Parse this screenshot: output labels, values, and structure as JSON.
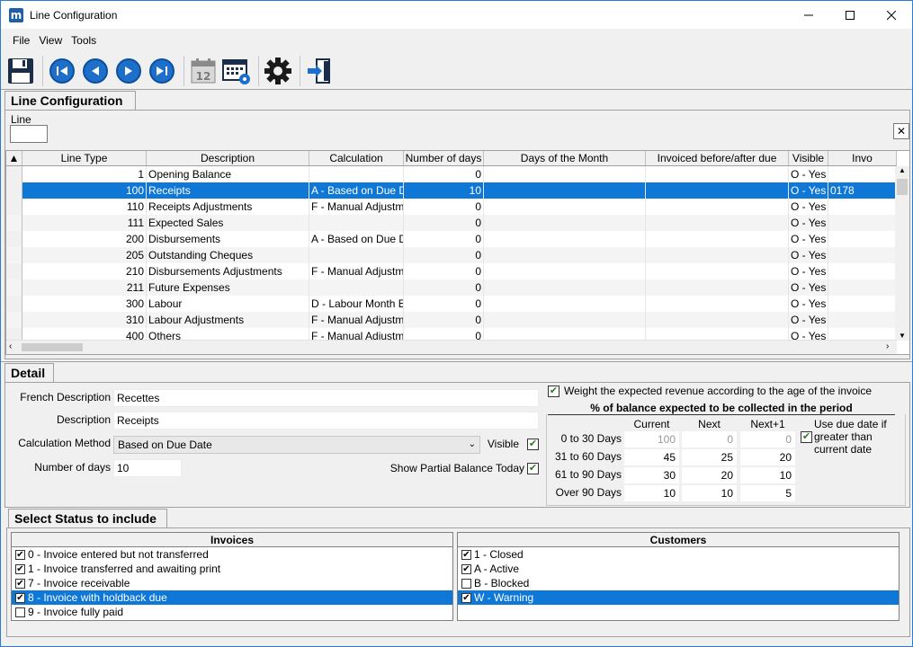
{
  "window": {
    "title": "Line Configuration",
    "app_icon_letter": "m"
  },
  "menu": [
    "File",
    "View",
    "Tools"
  ],
  "toolbar": {
    "icons": [
      "save-icon",
      "first-record-icon",
      "previous-record-icon",
      "next-record-icon",
      "last-record-icon",
      "calendar-icon",
      "calendar-settings-icon",
      "gear-icon",
      "exit-icon"
    ],
    "calendar_day": "12"
  },
  "top_tab": {
    "label": "Line Configuration",
    "line_label": "Line",
    "line_value": "",
    "close_glyph": "✕"
  },
  "grid": {
    "sort_glyph": "▲",
    "columns": [
      "Line Type",
      "Description",
      "Calculation",
      "Number of days",
      "Days of the Month",
      "Invoiced before/after due",
      "Visible",
      "Invo"
    ],
    "rows": [
      {
        "type": "1",
        "desc": "Opening Balance",
        "calc": "",
        "days": "0",
        "dom": "",
        "inv": "",
        "vis": "O - Yes",
        "invo": ""
      },
      {
        "type": "100",
        "desc": "Receipts",
        "calc": "A - Based on Due D",
        "days": "10",
        "dom": "",
        "inv": "",
        "vis": "O - Yes",
        "invo": "0178"
      },
      {
        "type": "110",
        "desc": "Receipts Adjustments",
        "calc": "F - Manual Adjustm",
        "days": "0",
        "dom": "",
        "inv": "",
        "vis": "O - Yes",
        "invo": ""
      },
      {
        "type": "111",
        "desc": "Expected Sales",
        "calc": "",
        "days": "0",
        "dom": "",
        "inv": "",
        "vis": "O - Yes",
        "invo": ""
      },
      {
        "type": "200",
        "desc": "Disbursements",
        "calc": "A - Based on Due D",
        "days": "0",
        "dom": "",
        "inv": "",
        "vis": "O - Yes",
        "invo": ""
      },
      {
        "type": "205",
        "desc": "Outstanding Cheques",
        "calc": "",
        "days": "0",
        "dom": "",
        "inv": "",
        "vis": "O - Yes",
        "invo": ""
      },
      {
        "type": "210",
        "desc": "Disbursements Adjustments",
        "calc": "F - Manual Adjustm",
        "days": "0",
        "dom": "",
        "inv": "",
        "vis": "O - Yes",
        "invo": ""
      },
      {
        "type": "211",
        "desc": "Future Expenses",
        "calc": "",
        "days": "0",
        "dom": "",
        "inv": "",
        "vis": "O - Yes",
        "invo": ""
      },
      {
        "type": "300",
        "desc": "Labour",
        "calc": "D - Labour Month E",
        "days": "0",
        "dom": "",
        "inv": "",
        "vis": "O - Yes",
        "invo": ""
      },
      {
        "type": "310",
        "desc": "Labour Adjustments",
        "calc": "F - Manual Adjustm",
        "days": "0",
        "dom": "",
        "inv": "",
        "vis": "O - Yes",
        "invo": ""
      },
      {
        "type": "400",
        "desc": "Others",
        "calc": "F - Manual Adjustm",
        "days": "0",
        "dom": "",
        "inv": "",
        "vis": "O - Yes",
        "invo": ""
      }
    ],
    "selected_index": 1
  },
  "detail": {
    "tab_label": "Detail",
    "french_label": "French Description",
    "french_value": "Recettes",
    "desc_label": "Description",
    "desc_value": "Receipts",
    "calc_label": "Calculation Method",
    "calc_value": "Based on Due Date",
    "days_label": "Number of days",
    "days_value": "10",
    "visible_label": "Visible",
    "visible_checked": true,
    "partial_label": "Show Partial Balance Today",
    "partial_checked": true,
    "weight_label": "Weight the expected revenue according to the age of the invoice",
    "weight_checked": true,
    "pct_title": "% of balance expected to be collected in the period",
    "pct_cols": [
      "Current",
      "Next",
      "Next+1"
    ],
    "pct_rows": [
      {
        "label": "0 to 30 Days",
        "vals": [
          "100",
          "0",
          "0"
        ],
        "disabled": true
      },
      {
        "label": "31 to 60 Days",
        "vals": [
          "45",
          "25",
          "20"
        ],
        "disabled": false
      },
      {
        "label": "61 to 90 Days",
        "vals": [
          "30",
          "20",
          "10"
        ],
        "disabled": false
      },
      {
        "label": "Over 90 Days",
        "vals": [
          "10",
          "10",
          "5"
        ],
        "disabled": false
      }
    ],
    "due_label_1": "Use due date if",
    "due_label_2": "greater than",
    "due_label_3": "current date",
    "due_checked": true
  },
  "status": {
    "tab_label": "Select Status to include",
    "invoices_header": "Invoices",
    "invoices": [
      {
        "label": "0 - Invoice entered but not transferred",
        "checked": true,
        "selected": false
      },
      {
        "label": "1 - Invoice transferred and awaiting print",
        "checked": true,
        "selected": false
      },
      {
        "label": "7 - Invoice receivable",
        "checked": true,
        "selected": false
      },
      {
        "label": "8 - Invoice with holdback due",
        "checked": true,
        "selected": true
      },
      {
        "label": "9 - Invoice fully paid",
        "checked": false,
        "selected": false
      }
    ],
    "customers_header": "Customers",
    "customers": [
      {
        "label": "1 - Closed",
        "checked": true,
        "selected": false
      },
      {
        "label": "A - Active",
        "checked": true,
        "selected": false
      },
      {
        "label": "B - Blocked",
        "checked": false,
        "selected": false
      },
      {
        "label": "W - Warning",
        "checked": true,
        "selected": true
      }
    ]
  },
  "colors": {
    "selection": "#0f78d7",
    "nav_blue": "#1e6fc9"
  }
}
